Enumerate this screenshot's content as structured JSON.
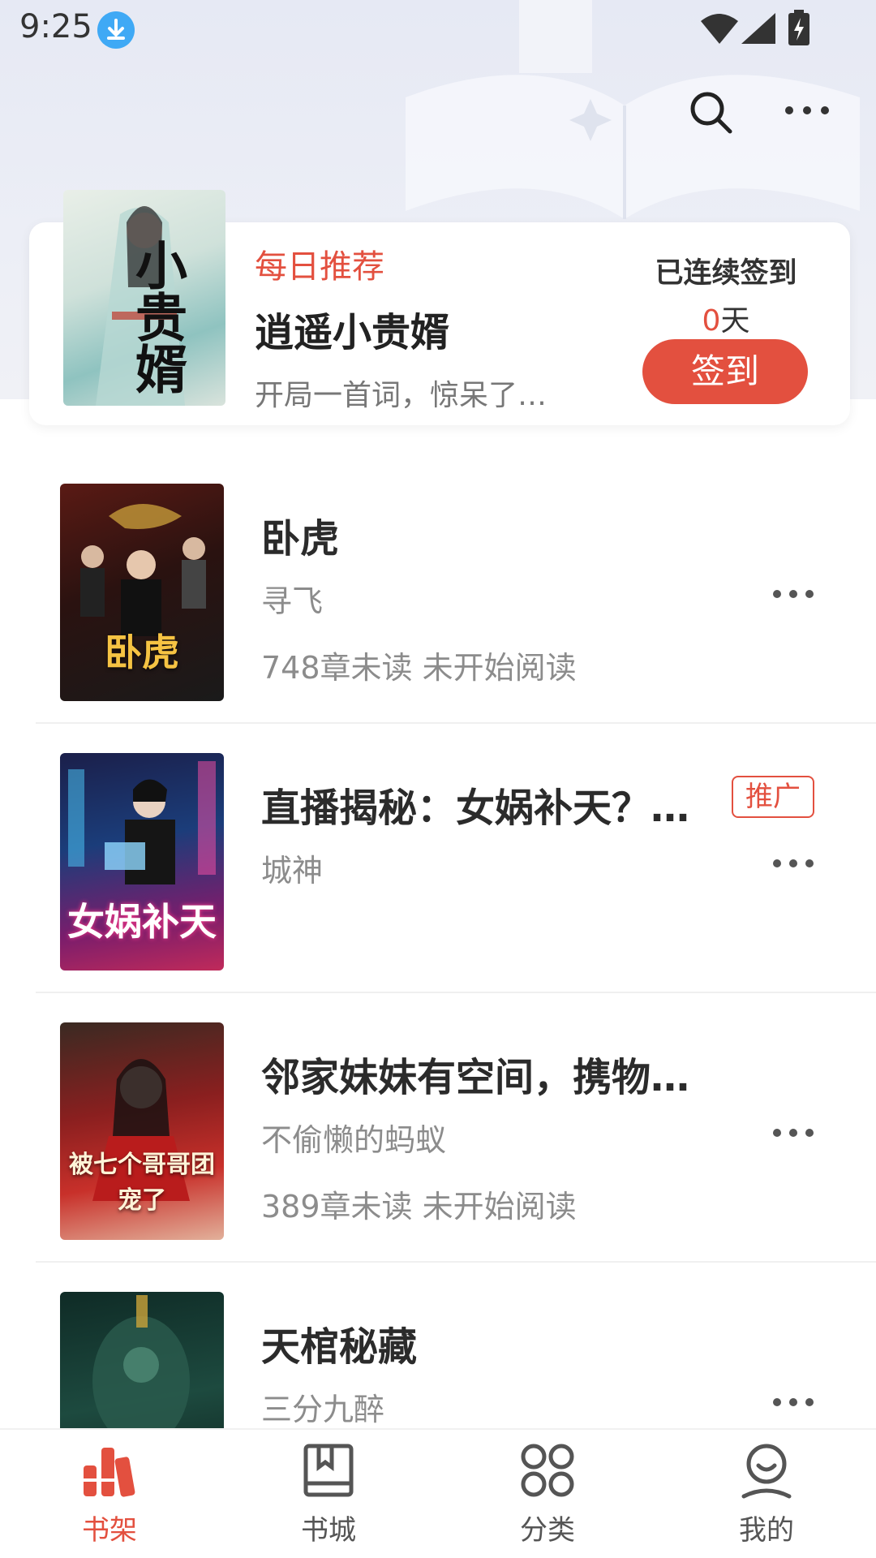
{
  "status_bar": {
    "time": "9:25"
  },
  "daily": {
    "label": "每日推荐",
    "title": "逍遥小贵婿",
    "desc": "开局一首词，惊呆了…",
    "cover_text": "小贵婿",
    "checkin_label": "已连续签到",
    "checkin_days": "0",
    "checkin_unit": "天",
    "checkin_button": "签到"
  },
  "books": [
    {
      "title": "卧虎",
      "author": "寻飞",
      "progress": "748章未读 未开始阅读",
      "cover_text": "卧虎",
      "promo": ""
    },
    {
      "title": "直播揭秘：女娲补天？…",
      "author": "城神",
      "progress": "",
      "cover_text": "女娲补天",
      "promo": "推广"
    },
    {
      "title": "邻家妹妹有空间，携物…",
      "author": "不偷懒的蚂蚁",
      "progress": "389章未读 未开始阅读",
      "cover_text": "被七个哥哥团宠了",
      "promo": ""
    },
    {
      "title": "天棺秘藏",
      "author": "三分九醉",
      "progress": "",
      "cover_text": "",
      "promo": ""
    }
  ],
  "nav": [
    {
      "label": "书架",
      "icon": "bookshelf-icon",
      "active": true
    },
    {
      "label": "书城",
      "icon": "bookstore-icon",
      "active": false
    },
    {
      "label": "分类",
      "icon": "category-icon",
      "active": false
    },
    {
      "label": "我的",
      "icon": "profile-icon",
      "active": false
    }
  ],
  "colors": {
    "accent": "#e3503f",
    "header_bg": "#e6e9f4"
  }
}
